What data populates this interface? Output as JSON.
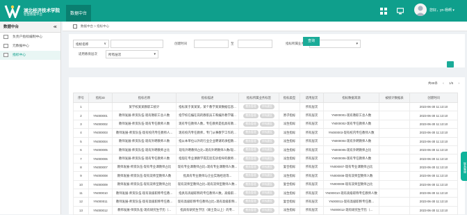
{
  "app": {
    "title": "湖北经济技术学院",
    "subtitle": "智慧数据平台",
    "active_tab": "数据中台",
    "user": "您好，yn-杨啊",
    "user_caret": "▾"
  },
  "sidebar": {
    "title": "数据中台",
    "collapse": "≪",
    "items": [
      {
        "label": "负责户指标编制中心"
      },
      {
        "label": "元数据中心"
      },
      {
        "label": "指标中心"
      }
    ]
  },
  "breadcrumb": {
    "text": "数据中台  >  指标中心"
  },
  "filter": {
    "name_select": "指标名称",
    "name_caret": "∨",
    "time_label": "创建时间",
    "time_sep": "至",
    "domain_label": "指标所属业务",
    "domain_value": "全部",
    "level_label": "适用教育层次",
    "level_value": "所有层次",
    "search_label": "查询"
  },
  "pager": {
    "total": "共88条",
    "prev": "‹",
    "page": "1/5",
    "next": "›"
  },
  "table": {
    "headers": [
      "序号",
      "指标ID",
      "指标名称",
      "指标描述",
      "指标所属业务标签",
      "指标类型",
      "适用层次",
      "指标数据来源",
      "被统计数据表",
      "创建时间"
    ],
    "tags": [
      "教务管理",
      "学科建设"
    ],
    "rows": [
      [
        "1",
        "",
        "某学校某某教职工统计",
        "指标某于某某某，某个教学某某数据信息...",
        "",
        "",
        "所有层次",
        "",
        "",
        "2023-06-30 11:13:10"
      ],
      [
        "2",
        "YN000001",
        "教师发展-师资队伍-现有教职工总人数",
        "指学校在编在岗的教职员工和编外教学辅...",
        "",
        "原子指标",
        "所有层次",
        "YN000001-现有教职工总人数",
        "",
        "2023-06-30 11:13:10"
      ],
      [
        "3",
        "YN000002",
        "教师发展-师资队伍-现有专任教师人数",
        "现有专任教师人数，专任教师是指具有教...",
        "",
        "派生指标",
        "所有层次",
        "YN000002-现有专任教师人数",
        "",
        "2023-06-30 11:13:10"
      ],
      [
        "4",
        "YN000003",
        "教师发展-师资队伍-现有校内专任教师人...",
        "现有校内专任教师，专门从事教学工作的...",
        "",
        "派生指标",
        "所有层次",
        "YN000003-现有校内专任教师人数",
        "",
        "2023-06-30 11:13:10"
      ],
      [
        "5",
        "YN000004",
        "教师发展-师资队伍-现有外聘教师人数",
        "指从本单位以外的行业企业聘请的承担教...",
        "",
        "派生指标",
        "所有层次",
        "YN000004-现有外聘教师人数",
        "",
        "2023-06-30 11:13:10"
      ],
      [
        "6",
        "YN000005",
        "教师发展-师资队伍-现有外聘教师占比",
        "现有外聘教师占比=现有外聘教师人数/现...",
        "",
        "派生指标",
        "所有层次",
        "YN000005-现有外聘教师占比",
        "",
        "2023-06-30 11:13:10"
      ],
      [
        "7",
        "YN000006",
        "教师发展-师资队伍-现有专任教师人数",
        "指现在专业课教学或实验实训指导的教师...",
        "",
        "派生指标",
        "所有层次",
        "YN000006-现有专任教师人数",
        "",
        "2023-06-30 11:13:10"
      ],
      [
        "8",
        "YN000007",
        "教师发展-师资队伍-现有专业课教师占比",
        "现有专业课教师占比=现有专业课教师人数...",
        "",
        "复合指标",
        "所有层次",
        "YN000007-现有专业课教师占比",
        "",
        "2023-06-30 11:13:10"
      ],
      [
        "9",
        "YN000008",
        "教师发展-师资队伍-现有双师型教师人数",
        "指具有专业教师与企业实践经验等...",
        "",
        "派生指标",
        "所有层次",
        "YN000008-现有双师型教师人数",
        "",
        "2023-06-30 11:13:10"
      ],
      [
        "10",
        "YN000009",
        "教师发展-师资队伍-现有双师型教师占比",
        "现有双师型教师占比=现有双师型教师人数...",
        "",
        "复合指标",
        "所有层次",
        "YN000009-现有双师型教师占比",
        "",
        "2023-06-30 11:13:10"
      ],
      [
        "11",
        "YN000010",
        "教师发展-师资队伍-现有高级职称专任教...",
        "指具有高级职称的专任教师人数，高级职...",
        "",
        "派生指标",
        "所有层次",
        "YN000010-现有高级职称专任教师人数",
        "",
        "2023-06-30 11:13:10"
      ],
      [
        "12",
        "YN000011",
        "教师发展-师资队伍-现有高级职称专任教...",
        "现有高级职称专任教师占比=现有高级职称...",
        "",
        "复合指标",
        "所有层次",
        "YN000011-现有高级职称专任教...",
        "",
        "2023-06-30 11:13:10"
      ],
      [
        "13",
        "YN000012",
        "教师发展-师资队伍-现有研究生学历（...",
        "指具有研究生学历（硕士及以上）的专...",
        "",
        "派生指标",
        "所有层次",
        "YN000012-现有研究生学历（...",
        "",
        "2023-06-30 11:13:10"
      ]
    ]
  },
  "float_label": "联系客服"
}
